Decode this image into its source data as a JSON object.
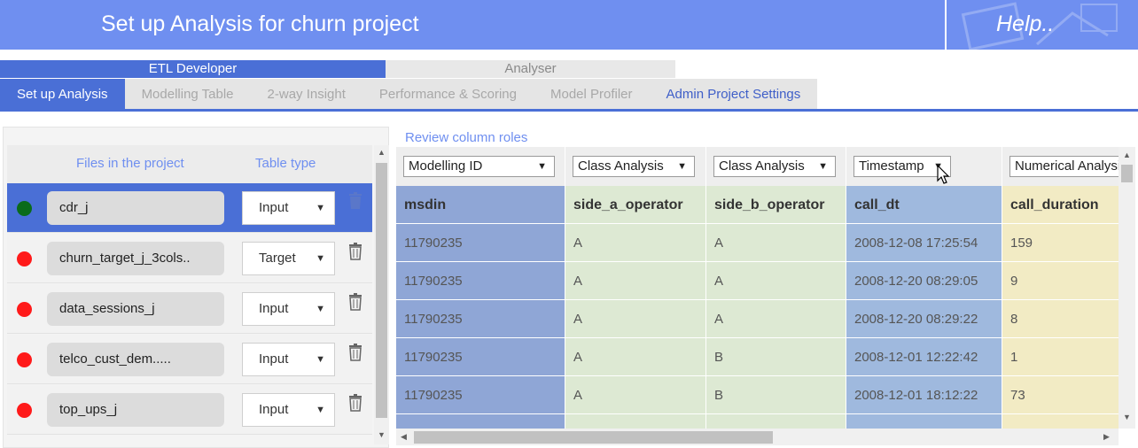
{
  "header": {
    "title": "Set up Analysis for churn project",
    "help": "Help.."
  },
  "roles": {
    "etl": "ETL Developer",
    "analyser": "Analyser"
  },
  "tabs": [
    {
      "label": "Set up Analysis"
    },
    {
      "label": "Modelling Table"
    },
    {
      "label": "2-way Insight"
    },
    {
      "label": "Performance & Scoring"
    },
    {
      "label": "Model Profiler"
    },
    {
      "label": "Admin Project Settings"
    }
  ],
  "files_panel": {
    "col_files": "Files in the project",
    "col_type": "Table type",
    "rows": [
      {
        "name": "cdr_j",
        "type": "Input",
        "status": "green"
      },
      {
        "name": "churn_target_j_3cols..",
        "type": "Target",
        "status": "red"
      },
      {
        "name": "data_sessions_j",
        "type": "Input",
        "status": "red"
      },
      {
        "name": "telco_cust_dem.....",
        "type": "Input",
        "status": "red"
      },
      {
        "name": "top_ups_j",
        "type": "Input",
        "status": "red"
      }
    ]
  },
  "review": {
    "title": "Review column roles",
    "columns": [
      {
        "role": "Modelling ID",
        "header": "msdin",
        "color": "#8fa6d6",
        "cells": [
          "11790235",
          "11790235",
          "11790235",
          "11790235",
          "11790235",
          ""
        ]
      },
      {
        "role": "Class Analysis",
        "header": "side_a_operator",
        "color": "#dde9d3",
        "cells": [
          "A",
          "A",
          "A",
          "A",
          "A",
          ""
        ]
      },
      {
        "role": "Class Analysis",
        "header": "side_b_operator",
        "color": "#dde9d3",
        "cells": [
          "A",
          "A",
          "A",
          "B",
          "B",
          ""
        ]
      },
      {
        "role": "Timestamp",
        "header": "call_dt",
        "color": "#9fb9de",
        "cells": [
          "2008-12-08 17:25:54",
          "2008-12-20 08:29:05",
          "2008-12-20 08:29:22",
          "2008-12-01 12:22:42",
          "2008-12-01 18:12:22",
          ""
        ]
      },
      {
        "role": "Numerical Analysis",
        "header": "call_duration",
        "color": "#f2ebc4",
        "cells": [
          "159",
          "9",
          "8",
          "1",
          "73",
          ""
        ]
      }
    ]
  }
}
